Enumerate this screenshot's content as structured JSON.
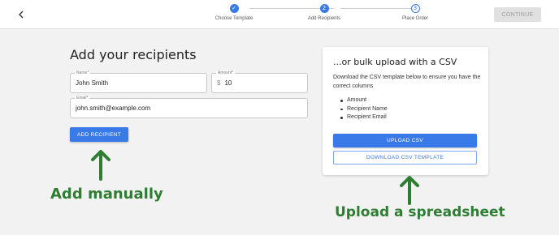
{
  "header": {
    "steps": [
      {
        "label": "Choose Template",
        "state": "done",
        "marker": "✓"
      },
      {
        "label": "Add Recipients",
        "state": "active",
        "marker": "2"
      },
      {
        "label": "Place Order",
        "state": "todo",
        "marker": "3"
      }
    ],
    "continue_label": "CONTINUE"
  },
  "form": {
    "title": "Add your recipients",
    "name": {
      "label": "Name*",
      "value": "John Smith"
    },
    "amount": {
      "label": "Amount*",
      "prefix": "$",
      "value": "10"
    },
    "email": {
      "label": "Email*",
      "value": "john.smith@example.com"
    },
    "add_button": "ADD RECIPIENT"
  },
  "bulk": {
    "title": "...or bulk upload with a CSV",
    "description": "Download the CSV template below to ensure you have the correct columns",
    "columns": [
      "Amount",
      "Recipient Name",
      "Recipient Email"
    ],
    "upload_button": "UPLOAD CSV",
    "download_button": "DOWNLOAD CSV TEMPLATE"
  },
  "annotations": {
    "left": "Add manually",
    "right": "Upload a spreadsheet",
    "color": "#2e7d32"
  },
  "colors": {
    "accent": "#3a79e8",
    "background": "#f2f2f2"
  }
}
